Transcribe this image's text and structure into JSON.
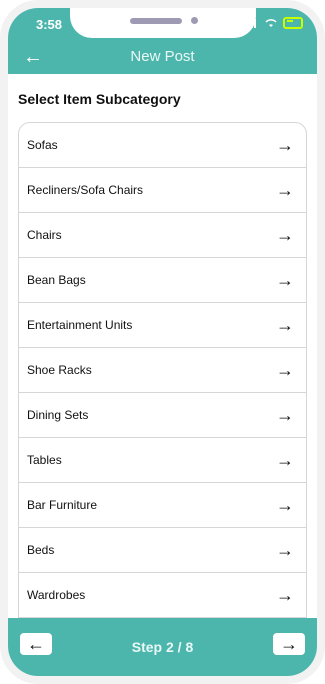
{
  "status_bar": {
    "time": "3:58"
  },
  "header": {
    "title": "New Post",
    "back_icon": "arrow-left-icon"
  },
  "section": {
    "title": "Select Item Subcategory"
  },
  "subcategories": [
    {
      "label": "Sofas"
    },
    {
      "label": "Recliners/Sofa Chairs"
    },
    {
      "label": "Chairs"
    },
    {
      "label": "Bean Bags"
    },
    {
      "label": "Entertainment Units"
    },
    {
      "label": "Shoe Racks"
    },
    {
      "label": "Dining Sets"
    },
    {
      "label": "Tables"
    },
    {
      "label": "Bar Furniture"
    },
    {
      "label": "Beds"
    },
    {
      "label": "Wardrobes"
    }
  ],
  "footer": {
    "step_text": "Step 2 / 8",
    "prev_icon": "arrow-left-icon",
    "next_icon": "arrow-right-icon"
  },
  "colors": {
    "accent": "#4db6ac"
  }
}
